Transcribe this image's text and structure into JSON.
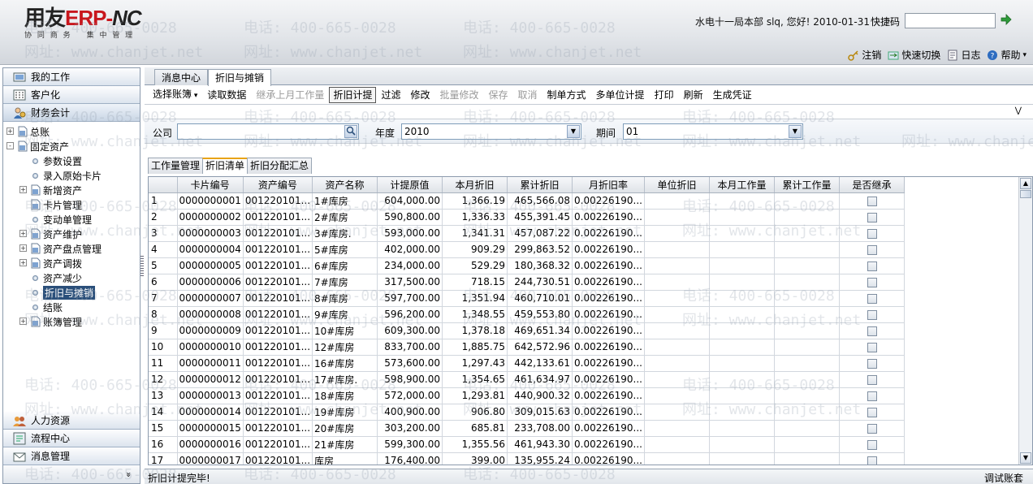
{
  "header": {
    "logo_main": "用友",
    "logo_erp": "ERP-",
    "logo_nc": "NC",
    "logo_sub": [
      "协 同 商 务",
      "集 中 管 理"
    ],
    "user_info": "水电十一局本部 slq, 您好! 2010-01-31",
    "quick_code_label": "快捷码",
    "links": [
      {
        "icon": "key-icon",
        "label": "注销"
      },
      {
        "icon": "switch-icon",
        "label": "快速切换"
      },
      {
        "icon": "log-icon",
        "label": "日志"
      },
      {
        "icon": "help-icon",
        "label": "帮助"
      }
    ]
  },
  "watermark": {
    "phone": "电话: 400-665-0028",
    "site": "网址: www.chanjet.net"
  },
  "sidebar": {
    "top_sections": [
      {
        "label": "我的工作",
        "icon": "work-icon"
      },
      {
        "label": "客户化",
        "icon": "customize-icon"
      },
      {
        "label": "财务会计",
        "icon": "finance-icon"
      }
    ],
    "tree": [
      {
        "label": "总账",
        "level": 0,
        "expand": "+",
        "type": "folder"
      },
      {
        "label": "固定资产",
        "level": 0,
        "expand": "-",
        "type": "folder"
      },
      {
        "label": "参数设置",
        "level": 1,
        "type": "leaf"
      },
      {
        "label": "录入原始卡片",
        "level": 1,
        "type": "leaf"
      },
      {
        "label": "新增资产",
        "level": 1,
        "expand": "+",
        "type": "folder"
      },
      {
        "label": "卡片管理",
        "level": 1,
        "type": "folder"
      },
      {
        "label": "变动单管理",
        "level": 1,
        "type": "leaf"
      },
      {
        "label": "资产维护",
        "level": 1,
        "expand": "+",
        "type": "folder"
      },
      {
        "label": "资产盘点管理",
        "level": 1,
        "expand": "+",
        "type": "folder"
      },
      {
        "label": "资产调拨",
        "level": 1,
        "expand": "+",
        "type": "folder"
      },
      {
        "label": "资产减少",
        "level": 1,
        "type": "leaf"
      },
      {
        "label": "折旧与摊销",
        "level": 1,
        "type": "leaf",
        "selected": true
      },
      {
        "label": "结账",
        "level": 1,
        "type": "leaf"
      },
      {
        "label": "账簿管理",
        "level": 1,
        "expand": "+",
        "type": "folder"
      }
    ],
    "bottom_sections": [
      {
        "label": "人力资源",
        "icon": "hr-icon"
      },
      {
        "label": "流程中心",
        "icon": "flow-icon"
      },
      {
        "label": "消息管理",
        "icon": "message-icon"
      }
    ],
    "footer_chevron": "»"
  },
  "main": {
    "tabs": [
      "消息中心",
      "折旧与摊销"
    ],
    "actions": [
      {
        "label": "选择账簿",
        "dropdown": true
      },
      {
        "label": "读取数据"
      },
      {
        "label": "继承上月工作量",
        "disabled": true
      },
      {
        "label": "折旧计提",
        "pressed": true
      },
      {
        "label": "过滤"
      },
      {
        "label": "修改"
      },
      {
        "label": "批量修改",
        "disabled": true
      },
      {
        "label": "保存",
        "disabled": true
      },
      {
        "label": "取消",
        "disabled": true
      },
      {
        "label": "制单方式"
      },
      {
        "label": "多单位计提"
      },
      {
        "label": "打印"
      },
      {
        "label": "刷新"
      },
      {
        "label": "生成凭证"
      }
    ],
    "filter": {
      "company_label": "公司",
      "company_value": "",
      "year_label": "年度",
      "year_value": "2010",
      "period_label": "期间",
      "period_value": "01"
    },
    "subtabs": [
      "工作量管理",
      "折旧清单",
      "折旧分配汇总"
    ],
    "columns": [
      "",
      "卡片编号",
      "资产编号",
      "资产名称",
      "计提原值",
      "本月折旧",
      "累计折旧",
      "月折旧率",
      "单位折旧",
      "本月工作量",
      "累计工作量",
      "是否继承"
    ],
    "rows": [
      [
        "1",
        "0000000001",
        "001220101...",
        "1#库房",
        "604,000.00",
        "1,366.19",
        "465,566.08",
        "0.00226190..."
      ],
      [
        "2",
        "0000000002",
        "001220101...",
        "2#库房",
        "590,800.00",
        "1,336.33",
        "455,391.45",
        "0.00226190..."
      ],
      [
        "3",
        "0000000003",
        "001220101...",
        "3#库房.",
        "593,000.00",
        "1,341.31",
        "457,087.22",
        "0.00226190..."
      ],
      [
        "4",
        "0000000004",
        "001220101...",
        "5#库房",
        "402,000.00",
        "909.29",
        "299,863.52",
        "0.00226190..."
      ],
      [
        "5",
        "0000000005",
        "001220101...",
        "6#库房",
        "234,000.00",
        "529.29",
        "180,368.32",
        "0.00226190..."
      ],
      [
        "6",
        "0000000006",
        "001220101...",
        "7#库房",
        "317,500.00",
        "718.15",
        "244,730.51",
        "0.00226190..."
      ],
      [
        "7",
        "0000000007",
        "001220101...",
        "8#库房",
        "597,700.00",
        "1,351.94",
        "460,710.01",
        "0.00226190..."
      ],
      [
        "8",
        "0000000008",
        "001220101...",
        "9#库房",
        "596,200.00",
        "1,348.55",
        "459,553.80",
        "0.00226190..."
      ],
      [
        "9",
        "0000000009",
        "001220101...",
        "10#库房",
        "609,300.00",
        "1,378.18",
        "469,651.34",
        "0.00226190..."
      ],
      [
        "10",
        "0000000010",
        "001220101...",
        "12#库房",
        "833,700.00",
        "1,885.75",
        "642,572.96",
        "0.00226190..."
      ],
      [
        "11",
        "0000000011",
        "001220101...",
        "16#库房",
        "573,600.00",
        "1,297.43",
        "442,133.61",
        "0.00226190..."
      ],
      [
        "12",
        "0000000012",
        "001220101...",
        "17#库房.",
        "598,900.00",
        "1,354.65",
        "461,634.97",
        "0.00226190..."
      ],
      [
        "13",
        "0000000013",
        "001220101...",
        "18#库房",
        "572,000.00",
        "1,293.81",
        "440,900.32",
        "0.00226190..."
      ],
      [
        "14",
        "0000000014",
        "001220101...",
        "19#库房",
        "400,900.00",
        "906.80",
        "309,015.63",
        "0.00226190..."
      ],
      [
        "15",
        "0000000015",
        "001220101...",
        "20#库房",
        "303,200.00",
        "685.81",
        "233,708.00",
        "0.00226190..."
      ],
      [
        "16",
        "0000000016",
        "001220101...",
        "21#库房",
        "599,300.00",
        "1,355.56",
        "461,943.30",
        "0.00226190..."
      ],
      [
        "17",
        "0000000017",
        "001220101...",
        "库房",
        "176,400.00",
        "399.00",
        "135,955.24",
        "0.00226190..."
      ]
    ]
  },
  "status": {
    "message": "折旧计提完毕!",
    "right": "调试账套"
  }
}
